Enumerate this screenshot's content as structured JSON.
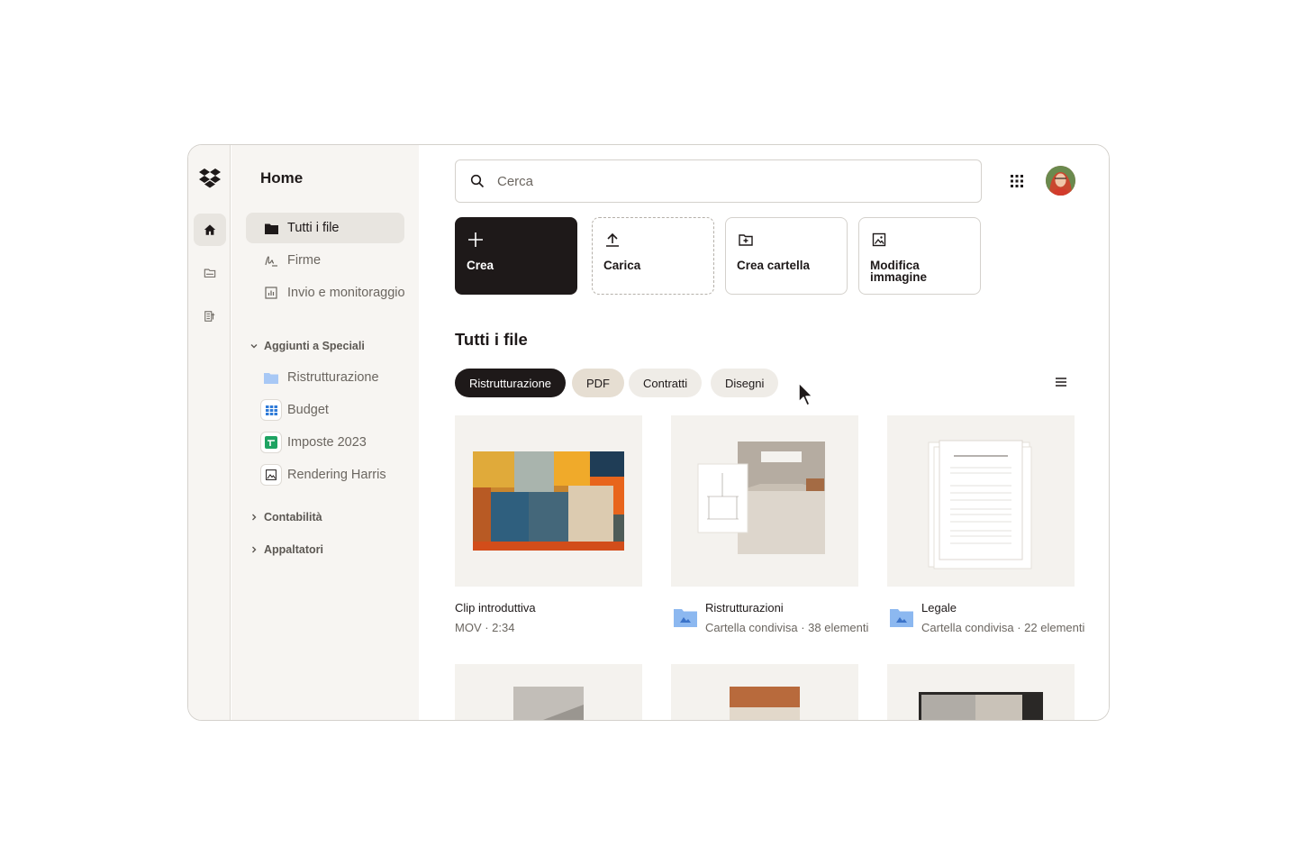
{
  "sidebar": {
    "title": "Home",
    "nav": [
      {
        "label": "Tutti i file",
        "icon": "folder-icon"
      },
      {
        "label": "Firme",
        "icon": "signature-icon"
      },
      {
        "label": "Invio e monitoraggio",
        "icon": "chart-icon"
      }
    ],
    "starred_section": "Aggiunti a Speciali",
    "starred": [
      {
        "label": "Ristrutturazione",
        "icon": "folder-icon"
      },
      {
        "label": "Budget",
        "icon": "spreadsheet-icon"
      },
      {
        "label": "Imposte 2023",
        "icon": "sheet-icon"
      },
      {
        "label": "Rendering Harris",
        "icon": "image-icon"
      }
    ],
    "sections": [
      "Contabilità",
      "Appaltatori"
    ]
  },
  "search": {
    "placeholder": "Cerca"
  },
  "actions": [
    "Crea",
    "Carica",
    "Crea cartella",
    "Modifica immagine"
  ],
  "main": {
    "title": "Tutti i file"
  },
  "filters": [
    "Ristrutturazione",
    "PDF",
    "Contratti",
    "Disegni"
  ],
  "files": [
    {
      "name": "Clip introduttiva",
      "meta": "MOV · 2:34"
    },
    {
      "name": "Ristrutturazioni",
      "meta": "Cartella condivisa · 38 elementi"
    },
    {
      "name": "Legale",
      "meta": "Cartella condivisa · 22 elementi"
    }
  ],
  "colors": {
    "accent": "#1e1919",
    "sidebar_bg": "#f7f5f2",
    "folder_blue": "#8cb8f0"
  }
}
